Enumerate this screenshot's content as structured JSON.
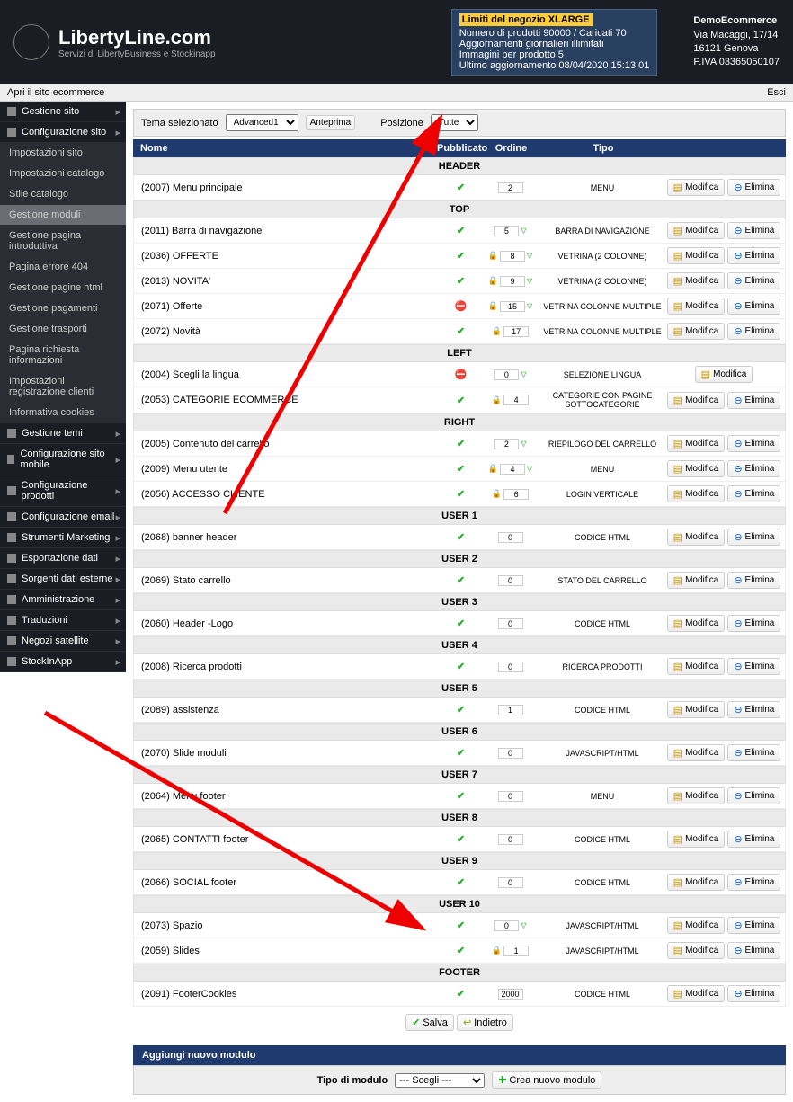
{
  "header": {
    "brand": "LibertyLine.com",
    "tagline": "Servizi di LibertyBusiness e Stockinapp",
    "notice_title": "Limiti del negozio XLARGE",
    "notice_l1": "Numero di prodotti 90000 / Caricati 70",
    "notice_l2": "Aggiornamenti giornalieri illimitati",
    "notice_l3": "Immagini per prodotto 5",
    "notice_l4": "Ultimo aggiornamento 08/04/2020 15:13:01",
    "info1": "DemoEcommerce",
    "info2": "Via Macaggi, 17/14",
    "info3": "16121 Genova",
    "info4": "P.IVA 03365050107"
  },
  "topbar": {
    "left": "Apri il sito ecommerce",
    "right": "Esci"
  },
  "sidebar": [
    {
      "label": "Gestione sito",
      "type": "main",
      "arrow": true
    },
    {
      "label": "Configurazione sito",
      "type": "main",
      "arrow": true,
      "open": true
    },
    {
      "label": "Impostazioni sito",
      "type": "sub"
    },
    {
      "label": "Impostazioni catalogo",
      "type": "sub"
    },
    {
      "label": "Stile catalogo",
      "type": "sub"
    },
    {
      "label": "Gestione moduli",
      "type": "sub",
      "selected": true
    },
    {
      "label": "Gestione pagina introduttiva",
      "type": "sub"
    },
    {
      "label": "Pagina errore 404",
      "type": "sub"
    },
    {
      "label": "Gestione pagine html",
      "type": "sub"
    },
    {
      "label": "Gestione pagamenti",
      "type": "sub"
    },
    {
      "label": "Gestione trasporti",
      "type": "sub"
    },
    {
      "label": "Pagina richiesta informazioni",
      "type": "sub"
    },
    {
      "label": "Impostazioni registrazione clienti",
      "type": "sub"
    },
    {
      "label": "Informativa cookies",
      "type": "sub"
    },
    {
      "label": "Gestione temi",
      "type": "main",
      "arrow": true
    },
    {
      "label": "Configurazione sito mobile",
      "type": "main",
      "arrow": true
    },
    {
      "label": "Configurazione prodotti",
      "type": "main",
      "arrow": true
    },
    {
      "label": "Configurazione email",
      "type": "main",
      "arrow": true
    },
    {
      "label": "Strumenti Marketing",
      "type": "main",
      "arrow": true
    },
    {
      "label": "Esportazione dati",
      "type": "main",
      "arrow": true
    },
    {
      "label": "Sorgenti dati esterne",
      "type": "main",
      "arrow": true
    },
    {
      "label": "Amministrazione",
      "type": "main",
      "arrow": true
    },
    {
      "label": "Traduzioni",
      "type": "main",
      "arrow": true
    },
    {
      "label": "Negozi satellite",
      "type": "main",
      "arrow": true
    },
    {
      "label": "StockInApp",
      "type": "main",
      "arrow": true
    }
  ],
  "filter": {
    "tema_label": "Tema selezionato",
    "tema_value": "Advanced1",
    "anteprima": "Anteprima",
    "pos_label": "Posizione",
    "pos_value": "Tutte"
  },
  "cols": {
    "name": "Nome",
    "pub": "Pubblicato",
    "ord": "Ordine",
    "tipo": "Tipo"
  },
  "btns": {
    "modifica": "Modifica",
    "elimina": "Elimina",
    "salva": "Salva",
    "indietro": "Indietro",
    "crea": "Crea nuovo modulo"
  },
  "sections": [
    {
      "head": "HEADER",
      "rows": [
        {
          "name": "(2007) Menu principale",
          "pub": true,
          "ord": "2",
          "tipo": "MENU",
          "up": false,
          "dn": false,
          "lock": false,
          "del": true
        }
      ]
    },
    {
      "head": "TOP",
      "rows": [
        {
          "name": "(2011) Barra di navigazione",
          "pub": true,
          "ord": "5",
          "tipo": "BARRA DI NAVIGAZIONE",
          "dn": true,
          "del": true
        },
        {
          "name": "(2036) OFFERTE",
          "pub": true,
          "ord": "8",
          "tipo": "VETRINA (2 COLONNE)",
          "lock": true,
          "dn": true,
          "del": true
        },
        {
          "name": "(2013) NOVITA'",
          "pub": true,
          "ord": "9",
          "tipo": "VETRINA (2 COLONNE)",
          "lock": true,
          "dn": true,
          "del": true
        },
        {
          "name": "(2071) Offerte",
          "pub": false,
          "ord": "15",
          "tipo": "VETRINA COLONNE MULTIPLE",
          "lock": true,
          "dn": true,
          "del": true
        },
        {
          "name": "(2072) Novità",
          "pub": true,
          "ord": "17",
          "tipo": "VETRINA COLONNE MULTIPLE",
          "lock": true,
          "del": true
        }
      ]
    },
    {
      "head": "LEFT",
      "rows": [
        {
          "name": "(2004) Scegli la lingua",
          "pub": false,
          "ord": "0",
          "tipo": "SELEZIONE LINGUA",
          "dn": true,
          "del": false
        },
        {
          "name": "(2053) CATEGORIE ECOMMERCE",
          "pub": true,
          "ord": "4",
          "tipo": "CATEGORIE CON PAGINE SOTTOCATEGORIE",
          "lock": true,
          "del": true
        }
      ]
    },
    {
      "head": "RIGHT",
      "rows": [
        {
          "name": "(2005) Contenuto del carrello",
          "pub": true,
          "ord": "2",
          "tipo": "RIEPILOGO DEL CARRELLO",
          "dn": true,
          "del": true
        },
        {
          "name": "(2009) Menu utente",
          "pub": true,
          "ord": "4",
          "tipo": "MENU",
          "lock": true,
          "dn": true,
          "del": true
        },
        {
          "name": "(2056) ACCESSO CLIENTE",
          "pub": true,
          "ord": "6",
          "tipo": "LOGIN VERTICALE",
          "lock": true,
          "del": true
        }
      ]
    },
    {
      "head": "USER 1",
      "rows": [
        {
          "name": "(2068) banner header",
          "pub": true,
          "ord": "0",
          "tipo": "CODICE HTML",
          "del": true
        }
      ]
    },
    {
      "head": "USER 2",
      "rows": [
        {
          "name": "(2069) Stato carrello",
          "pub": true,
          "ord": "0",
          "tipo": "STATO DEL CARRELLO",
          "del": true
        }
      ]
    },
    {
      "head": "USER 3",
      "rows": [
        {
          "name": "(2060) Header -Logo",
          "pub": true,
          "ord": "0",
          "tipo": "CODICE HTML",
          "del": true
        }
      ]
    },
    {
      "head": "USER 4",
      "rows": [
        {
          "name": "(2008) Ricerca prodotti",
          "pub": true,
          "ord": "0",
          "tipo": "RICERCA PRODOTTI",
          "del": true
        }
      ]
    },
    {
      "head": "USER 5",
      "rows": [
        {
          "name": "(2089) assistenza",
          "pub": true,
          "ord": "1",
          "tipo": "CODICE HTML",
          "del": true
        }
      ]
    },
    {
      "head": "USER 6",
      "rows": [
        {
          "name": "(2070) Slide moduli",
          "pub": true,
          "ord": "0",
          "tipo": "JAVASCRIPT/HTML",
          "del": true
        }
      ]
    },
    {
      "head": "USER 7",
      "rows": [
        {
          "name": "(2064) Menu footer",
          "pub": true,
          "ord": "0",
          "tipo": "MENU",
          "del": true
        }
      ]
    },
    {
      "head": "USER 8",
      "rows": [
        {
          "name": "(2065) CONTATTI footer",
          "pub": true,
          "ord": "0",
          "tipo": "CODICE HTML",
          "del": true
        }
      ]
    },
    {
      "head": "USER 9",
      "rows": [
        {
          "name": "(2066) SOCIAL footer",
          "pub": true,
          "ord": "0",
          "tipo": "CODICE HTML",
          "del": true
        }
      ]
    },
    {
      "head": "USER 10",
      "rows": [
        {
          "name": "(2073) Spazio",
          "pub": true,
          "ord": "0",
          "tipo": "JAVASCRIPT/HTML",
          "dn": true,
          "del": true
        },
        {
          "name": "(2059) Slides",
          "pub": true,
          "ord": "1",
          "tipo": "JAVASCRIPT/HTML",
          "lock": true,
          "del": true
        }
      ]
    },
    {
      "head": "FOOTER",
      "rows": [
        {
          "name": "(2091) FooterCookies",
          "pub": true,
          "ord": "2000",
          "tipo": "CODICE HTML",
          "del": true
        }
      ]
    }
  ],
  "add": {
    "title": "Aggiungi nuovo modulo",
    "label": "Tipo di modulo",
    "placeholder": "--- Scegli ---"
  }
}
